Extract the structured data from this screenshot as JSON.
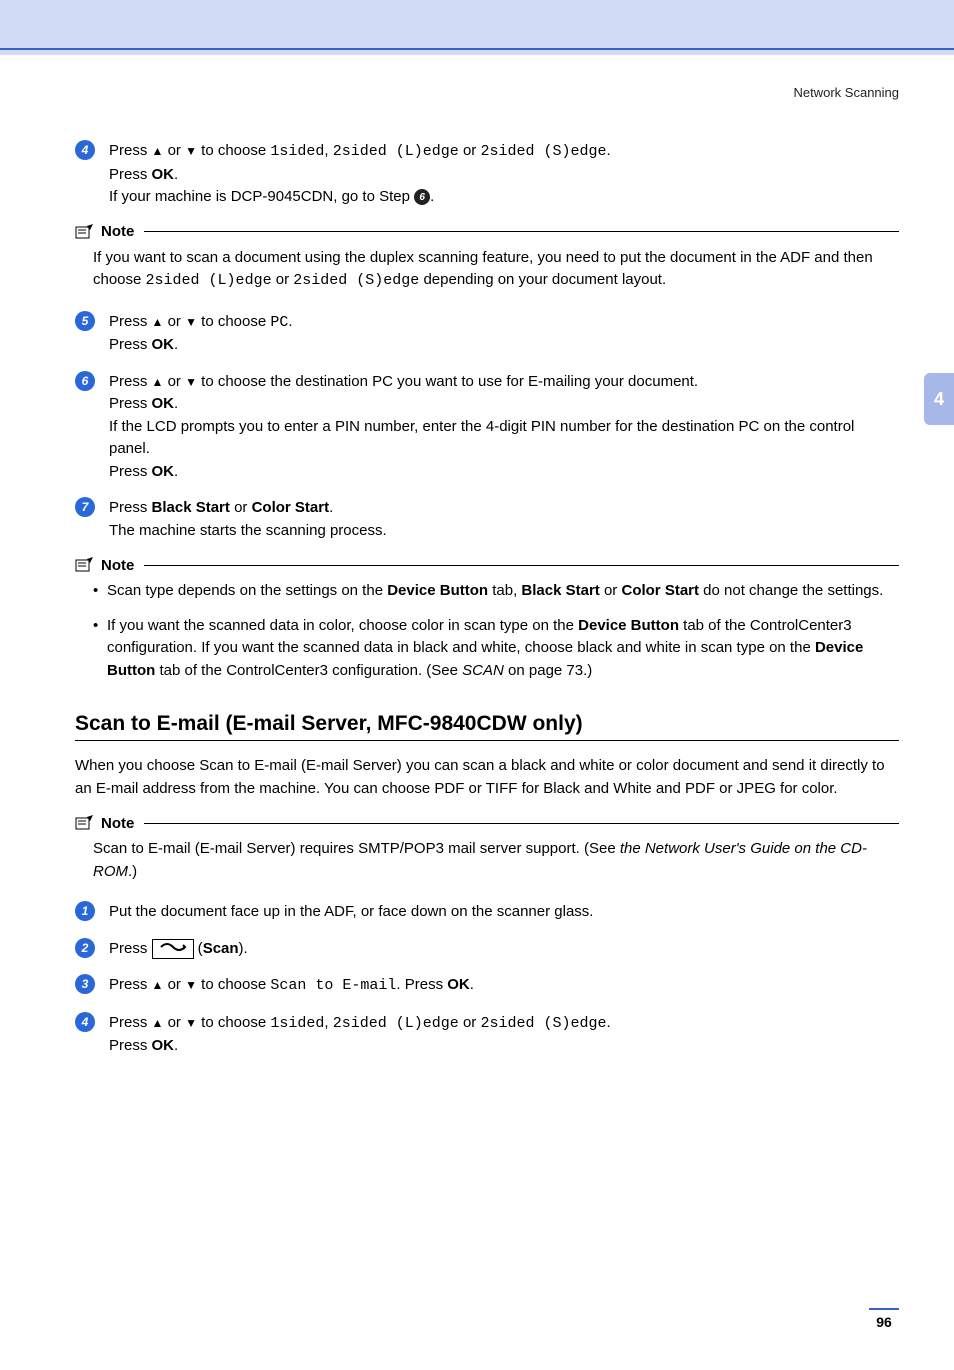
{
  "header": {
    "section": "Network Scanning"
  },
  "sideTab": "4",
  "pageNumber": "96",
  "noteLabel": "Note",
  "strings": {
    "press": "Press",
    "or": "or",
    "toChoose": "to choose",
    "pressOK": "Press ",
    "ok": "OK",
    "comma": ", ",
    "period": ".",
    "oneSided": "1sided",
    "twoSidedL": "2sided (L)edge",
    "twoSidedS": "2sided (S)edge",
    "ifDCP": "If your machine is DCP-9045CDN, go to Step ",
    "stepRef6": "6",
    "note1a": "If you want to scan a document using the duplex scanning feature, you need to put the document in the ADF and then choose ",
    "note1b": " or ",
    "note1c": " depending on your document layout.",
    "pc": "PC",
    "step6a": " to choose the destination PC you want to use for E-mailing your document.",
    "step6b": "If the LCD prompts you to enter a PIN number, enter the 4-digit PIN number for the destination PC on the control panel.",
    "blackStart": "Black Start",
    "colorStart": "Color Start",
    "step7b": "The machine starts the scanning process.",
    "note2_li1a": "Scan type depends on the settings on the ",
    "deviceButton": "Device Button",
    "note2_li1b": " tab, ",
    "note2_li1c": " or ",
    "note2_li1d": " do not change the settings.",
    "note2_li2a": "If you want the scanned data in color, choose color in scan type on the ",
    "note2_li2b": " tab of the ControlCenter3 configuration. If you want the scanned data in black and white, choose black and white in scan type on the ",
    "note2_li2c": " tab of the ControlCenter3 configuration. (See ",
    "scanRef": "SCAN",
    "note2_li2d": " on page 73.)",
    "sectionTitle": "Scan to E-mail (E-mail Server, MFC-9840CDW only)",
    "intro": "When you choose Scan to E-mail (E-mail Server) you can scan a black and white or color document and send it directly to an E-mail address from the machine. You can choose PDF or TIFF for Black and White and PDF or JPEG for color.",
    "note3a": "Scan to E-mail (E-mail Server) requires SMTP/POP3 mail server support. (See ",
    "note3b": "the Network User's Guide on the CD-ROM",
    "note3c": ".)",
    "newStep1": "Put the document face up in the ADF, or face down on the scanner glass.",
    "scan": "Scan",
    "scanToEmail": "Scan to E-mail",
    "pressLabel": ". Press "
  },
  "bullets": {
    "s4": "4",
    "s5": "5",
    "s6": "6",
    "s7": "7",
    "n1": "1",
    "n2": "2",
    "n3": "3",
    "n4": "4"
  }
}
